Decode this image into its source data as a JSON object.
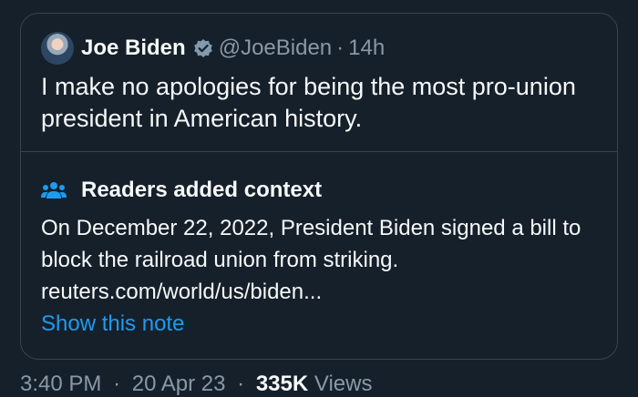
{
  "tweet": {
    "author_name": "Joe Biden",
    "handle": "@JoeBiden",
    "separator": "·",
    "age": "14h",
    "text": "I make no apologies for being the most pro-union president in American history."
  },
  "community_note": {
    "title": "Readers added context",
    "text": "On December 22, 2022, President Biden signed a bill to block the railroad union from striking.",
    "link": "reuters.com/world/us/biden...",
    "show_note_label": "Show this note"
  },
  "footer": {
    "time": "3:40 PM",
    "separator": "·",
    "date": "20 Apr 23",
    "views_count": "335K",
    "views_label": "Views"
  },
  "colors": {
    "background": "#15202b",
    "border": "#38444d",
    "primary_text": "#f7f9f9",
    "secondary_text": "#8b98a5",
    "accent": "#1d9bf0",
    "verified_badge": "#829aab"
  },
  "icons": {
    "badge": "verified-badge-icon",
    "note": "people-icon"
  }
}
